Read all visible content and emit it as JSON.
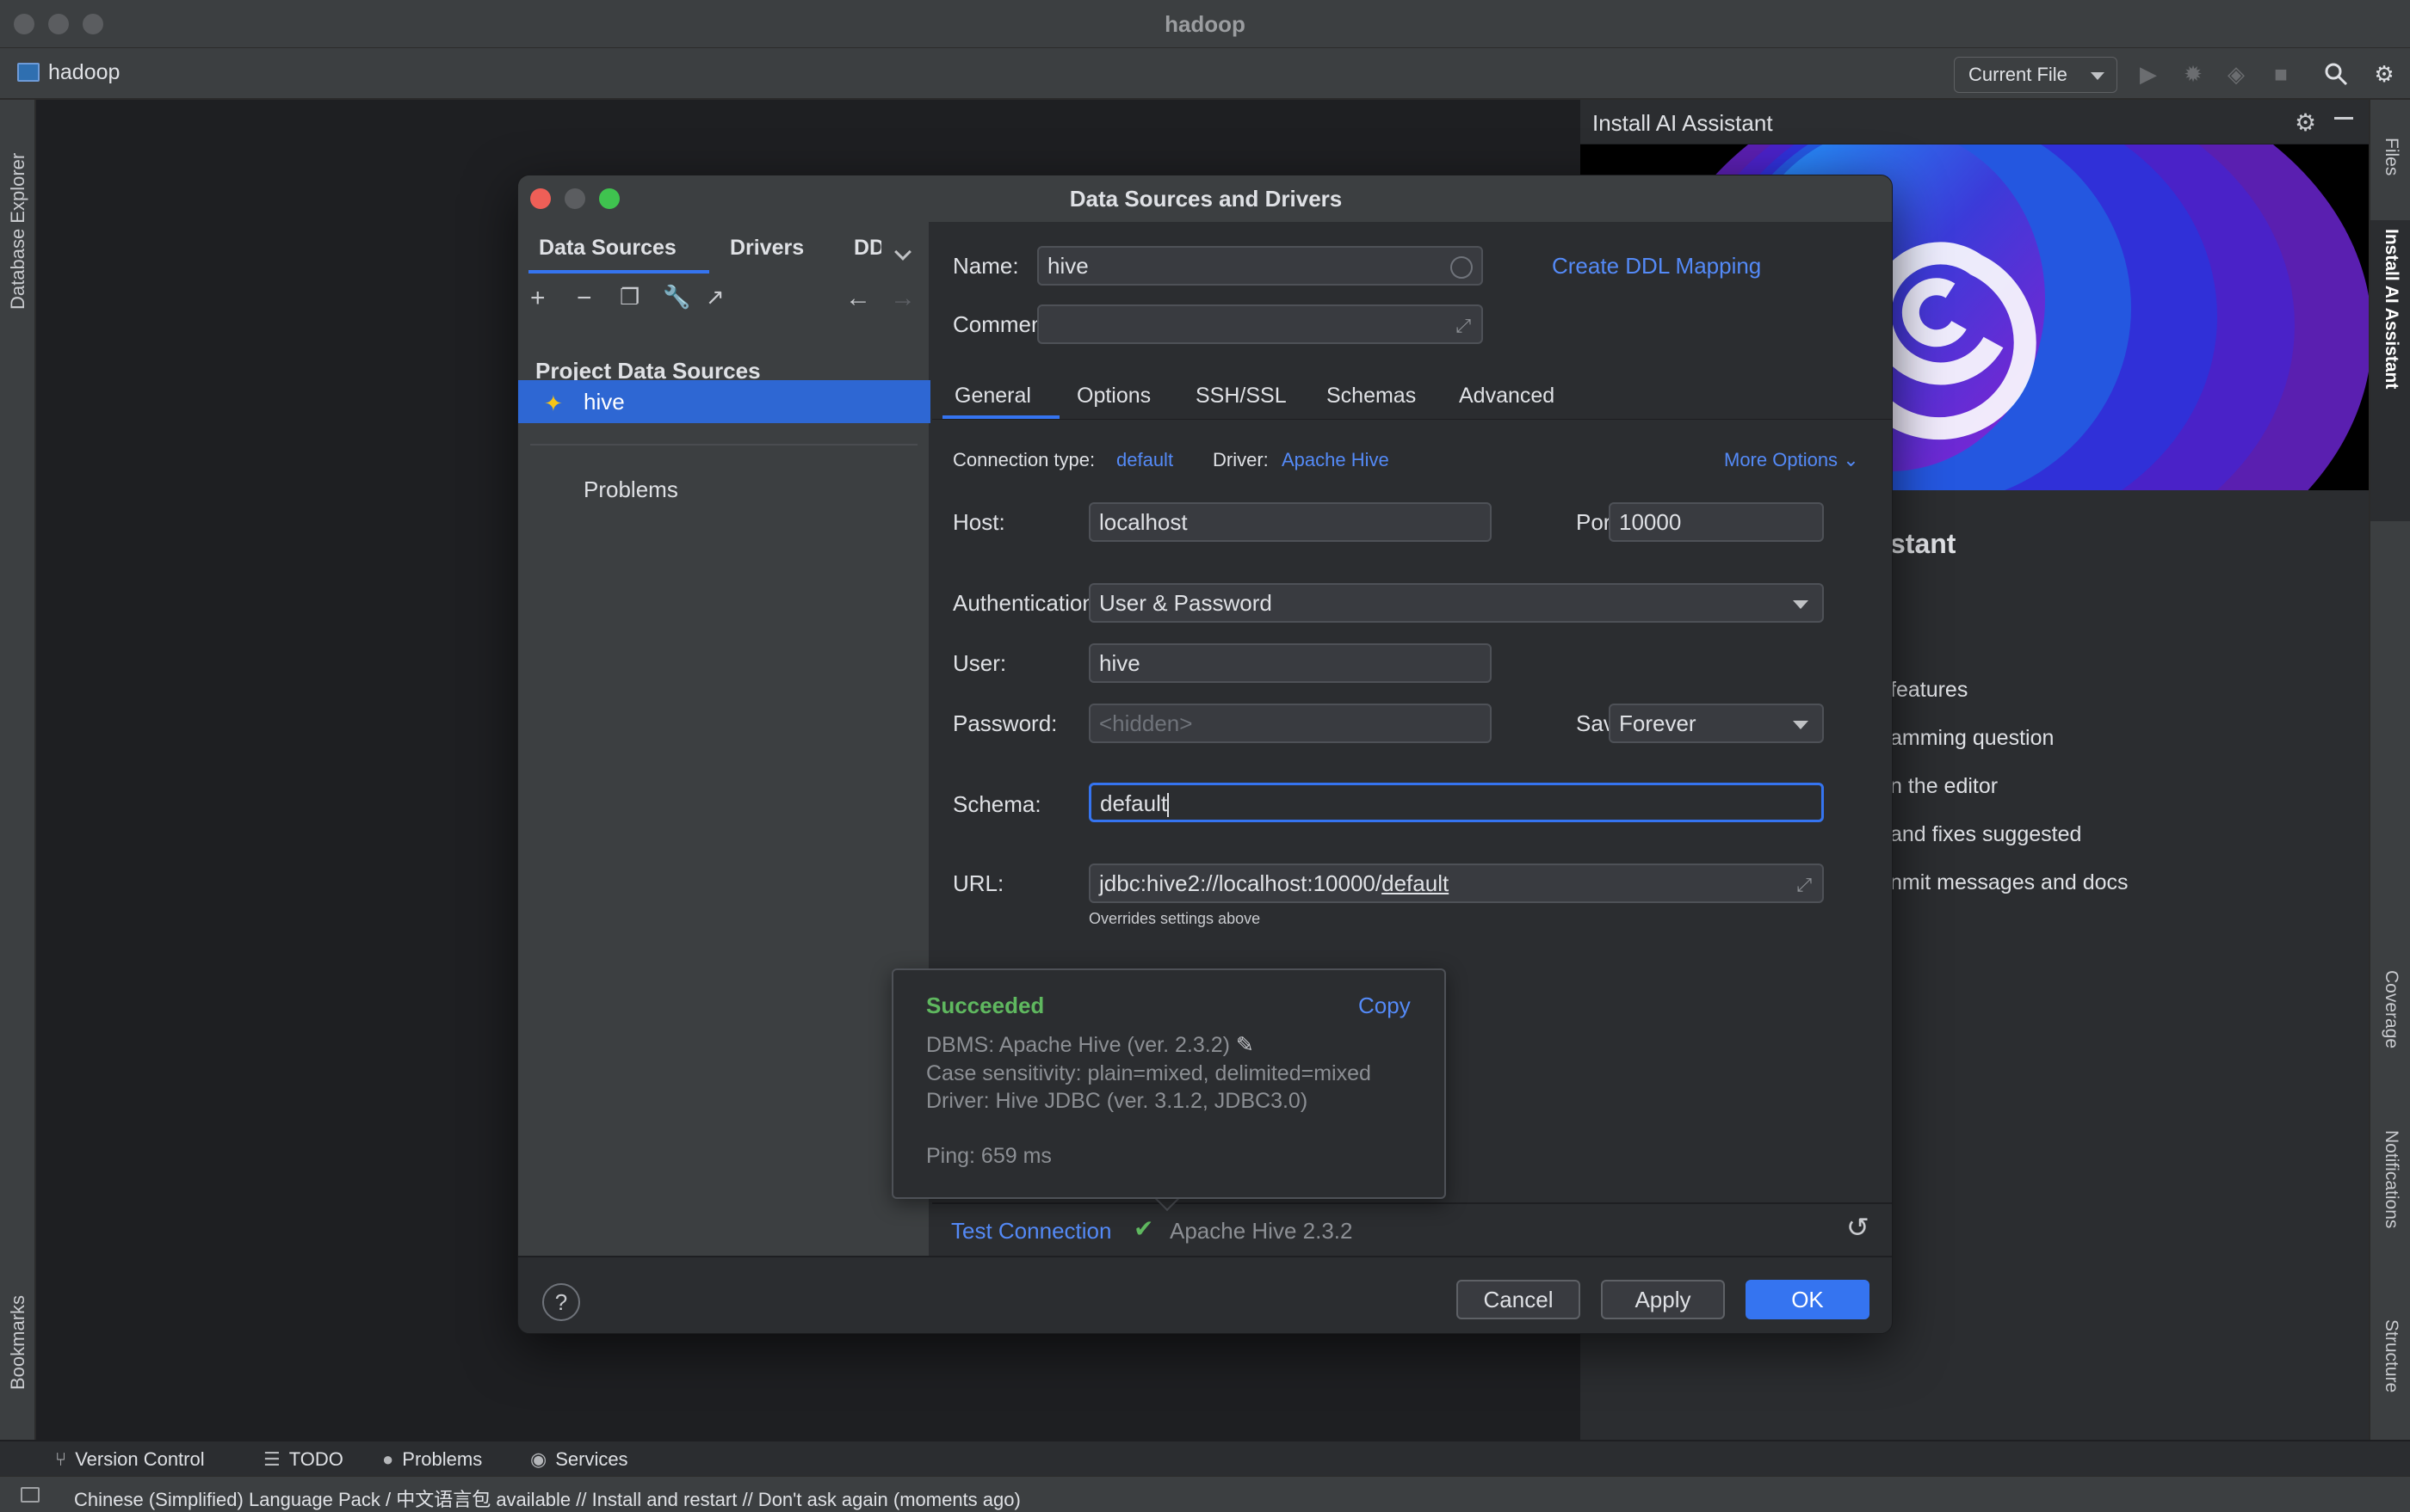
{
  "window": {
    "title": "hadoop",
    "project": "hadoop"
  },
  "toolbar": {
    "run_config": "Current File"
  },
  "left_strip": {
    "top_label": "Database Explorer",
    "bottom_label": "Bookmarks"
  },
  "right_strip": {
    "files": "Files",
    "ai": "Install AI Assistant",
    "coverage": "Coverage",
    "notifications": "Notifications",
    "structure": "Structure"
  },
  "ai_panel": {
    "title": "Install AI Assistant",
    "heading": "stant",
    "lines": [
      "features",
      "amming question",
      "n the editor",
      "and fixes suggested",
      "nmit messages and docs"
    ]
  },
  "bottom_tools": [
    "Version Control",
    "TODO",
    "Problems",
    "Services"
  ],
  "status": {
    "message": "Chinese (Simplified) Language Pack / 中文语言包 available // Install and restart // Don't ask again (moments ago)"
  },
  "dialog": {
    "title": "Data Sources and Drivers",
    "left_tabs": [
      "Data Sources",
      "Drivers",
      "DD"
    ],
    "section": "Project Data Sources",
    "selected_source": "hive",
    "problems": "Problems",
    "name_label": "Name:",
    "name_value": "hive",
    "comment_label": "Comment:",
    "comment_value": "",
    "ddl_link": "Create DDL Mapping",
    "tabs": [
      "General",
      "Options",
      "SSH/SSL",
      "Schemas",
      "Advanced"
    ],
    "active_tab": "General",
    "connection_type_label": "Connection type:",
    "connection_type": "default",
    "driver_label": "Driver:",
    "driver": "Apache Hive",
    "more_options": "More Options",
    "host_label": "Host:",
    "host": "localhost",
    "port_label": "Port:",
    "port": "10000",
    "auth_label": "Authentication:",
    "auth": "User & Password",
    "user_label": "User:",
    "user": "hive",
    "password_label": "Password:",
    "password_placeholder": "<hidden>",
    "save_label": "Save:",
    "save": "Forever",
    "schema_label": "Schema:",
    "schema": "default",
    "url_label": "URL:",
    "url_prefix": "jdbc:hive2://localhost:10000/",
    "url_db": "default",
    "url_note": "Overrides settings above",
    "test_connection": "Test Connection",
    "test_result": "Apache Hive 2.3.2",
    "buttons": {
      "cancel": "Cancel",
      "apply": "Apply",
      "ok": "OK"
    }
  },
  "popup": {
    "status": "Succeeded",
    "copy": "Copy",
    "dbms": "DBMS: Apache Hive (ver. 2.3.2)",
    "case": "Case sensitivity: plain=mixed, delimited=mixed",
    "driver": "Driver: Hive JDBC (ver. 3.1.2, JDBC3.0)",
    "ping": "Ping: 659 ms"
  },
  "colors": {
    "accent": "#3574f0",
    "link": "#548af7",
    "success": "#5fb85f",
    "selection": "#2e67d3"
  }
}
